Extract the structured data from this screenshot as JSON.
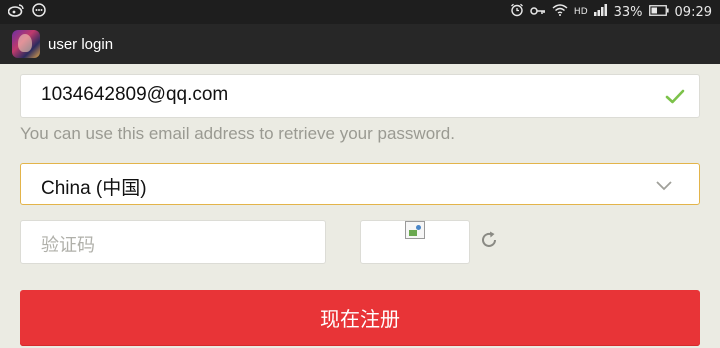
{
  "status_bar": {
    "battery_percent": "33%",
    "time": "09:29",
    "network": "HD",
    "icons": [
      "weibo-icon",
      "chat-icon",
      "alarm-icon",
      "key-icon",
      "wifi-icon",
      "signal-icon",
      "battery-icon"
    ]
  },
  "header": {
    "title": "user login",
    "app_icon": "app-icon"
  },
  "form": {
    "email_value": "1034642809@qq.com",
    "email_valid_icon": "check-icon",
    "email_hint": "You can use this email address to retrieve your password.",
    "country_value": "China (中国)",
    "captcha_placeholder": "验证码",
    "register_label": "现在注册"
  },
  "colors": {
    "accent_red": "#e83437",
    "focus_border": "#e3b44a",
    "check_green": "#7cc24a"
  }
}
